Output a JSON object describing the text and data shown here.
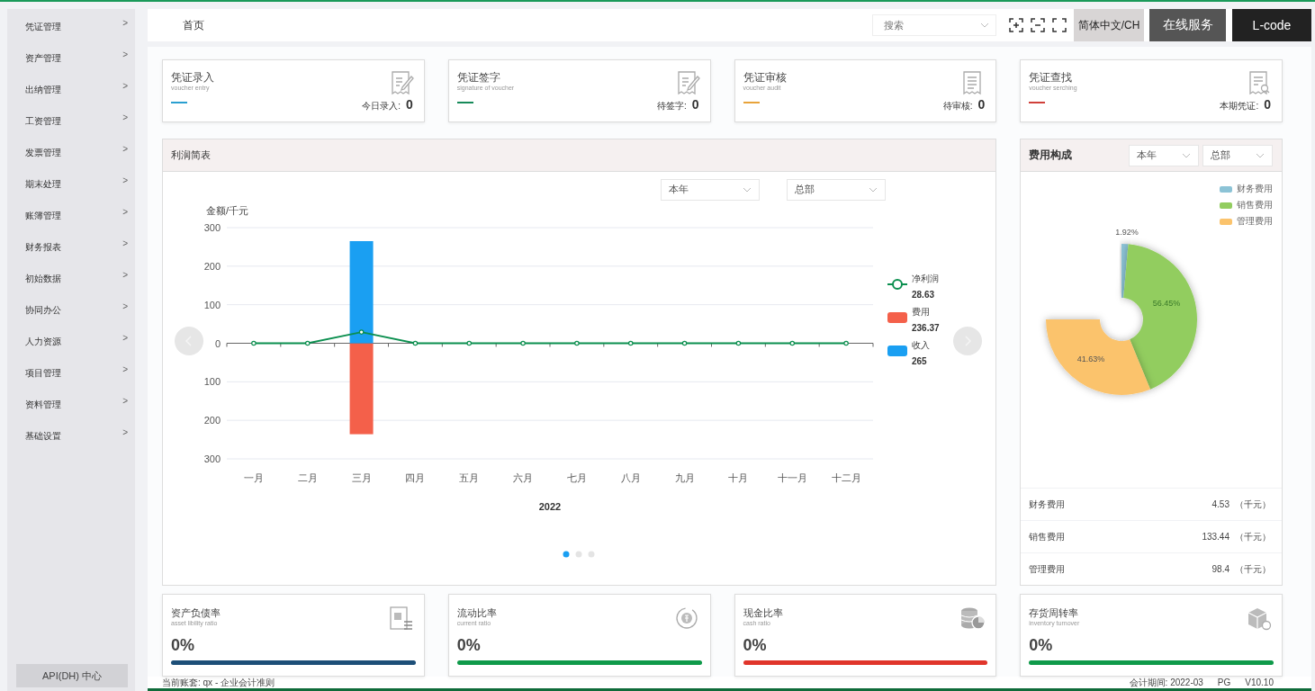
{
  "sidebar": {
    "items": [
      {
        "label": "凭证管理"
      },
      {
        "label": "资产管理"
      },
      {
        "label": "出纳管理"
      },
      {
        "label": "工资管理"
      },
      {
        "label": "发票管理"
      },
      {
        "label": "期末处理"
      },
      {
        "label": "账簿管理"
      },
      {
        "label": "财务报表"
      },
      {
        "label": "初始数据"
      },
      {
        "label": "协同办公"
      },
      {
        "label": "人力资源"
      },
      {
        "label": "项目管理"
      },
      {
        "label": "资料管理"
      },
      {
        "label": "基础设置"
      }
    ],
    "chevron": ">",
    "bottom_button": "API(DH) 中心"
  },
  "top_bar": {
    "tab": "首页",
    "search": {
      "placeholder": "搜索"
    },
    "language": "简体中文/CH",
    "service_button": "在线服务",
    "code_button": "L-code"
  },
  "stat_cards": [
    {
      "title": "凭证录入",
      "subtitle": "voucher entry",
      "color": "#2a9fd0",
      "count_label": "今日录入:",
      "count": "0"
    },
    {
      "title": "凭证签字",
      "subtitle": "signature of voucher",
      "color": "#178a5a",
      "count_label": "待签字:",
      "count": "0"
    },
    {
      "title": "凭证审核",
      "subtitle": "voucher audit",
      "color": "#e8a33a",
      "count_label": "待审核:",
      "count": "0"
    },
    {
      "title": "凭证查找",
      "subtitle": "voucher serching",
      "color": "#d0403a",
      "count_label": "本期凭证:",
      "count": "0"
    }
  ],
  "profit_panel": {
    "title": "利润简表",
    "filters": [
      "本年",
      "总部"
    ],
    "chart_data": {
      "type": "bar",
      "ylabel": "金额/千元",
      "xlabel": "2022",
      "categories": [
        "一月",
        "二月",
        "三月",
        "四月",
        "五月",
        "六月",
        "七月",
        "八月",
        "九月",
        "十月",
        "十一月",
        "十二月"
      ],
      "ylim": [
        -300,
        300
      ],
      "yticks": [
        {
          "value": 300,
          "label": "300"
        },
        {
          "value": 200,
          "label": "200"
        },
        {
          "value": 100,
          "label": "100"
        },
        {
          "value": 0,
          "label": "0"
        },
        {
          "value": -100,
          "label": "100"
        },
        {
          "value": -200,
          "label": "200"
        },
        {
          "value": -300,
          "label": "300"
        }
      ],
      "grid": true,
      "legend": "right",
      "series": [
        {
          "name": "净利润",
          "type": "line",
          "marker": "circle",
          "color": "#0b8f4f",
          "values": [
            0,
            0,
            29,
            0,
            0,
            0,
            0,
            0,
            0,
            0,
            0,
            0
          ]
        },
        {
          "name": "费用",
          "color": "#f4604a",
          "values": [
            0,
            0,
            -236,
            0,
            0,
            0,
            0,
            0,
            0,
            0,
            0,
            0
          ]
        },
        {
          "name": "收入",
          "color": "#1a9ff2",
          "values": [
            0,
            0,
            265,
            0,
            0,
            0,
            0,
            0,
            0,
            0,
            0,
            0
          ]
        }
      ]
    },
    "legend_values": [
      "28.63",
      "236.37",
      "265"
    ],
    "pager": [
      {
        "selected": true
      },
      {
        "selected": false
      },
      {
        "selected": false
      }
    ]
  },
  "expense_panel": {
    "title": "费用构成",
    "filters": [
      "本年",
      "总部"
    ],
    "chart_data": {
      "type": "donut",
      "categories": [
        "财务费用",
        "销售费用",
        "管理费用"
      ],
      "values": [
        1.92,
        56.45,
        41.63
      ],
      "value_labels": [
        "1.92%",
        "56.45%",
        "41.63%"
      ],
      "colors": [
        "#8cc3d6",
        "#92cd5f",
        "#fbc36c"
      ]
    },
    "rows": [
      {
        "name": "财务费用",
        "value": "4.53",
        "unit": "（千元）"
      },
      {
        "name": "销售费用",
        "value": "133.44",
        "unit": "（千元）"
      },
      {
        "name": "管理费用",
        "value": "98.4",
        "unit": "（千元）"
      }
    ]
  },
  "ratio_cards": [
    {
      "title": "资产负债率",
      "subtitle": "asset libility ratio",
      "value": "0%",
      "color": "#1d4f78"
    },
    {
      "title": "流动比率",
      "subtitle": "current ratio",
      "value": "0%",
      "color": "#0f9a4a"
    },
    {
      "title": "现金比率",
      "subtitle": "cash ratio",
      "value": "0%",
      "color": "#e0352b"
    },
    {
      "title": "存货周转率",
      "subtitle": "inventory turnover",
      "value": "0%",
      "color": "#0f9a4a"
    }
  ],
  "status_bar": {
    "account": "当前账套: qx - 企业会计准则",
    "period": "会计期间: 2022-03",
    "edition": "PG",
    "version": "V10.10"
  }
}
